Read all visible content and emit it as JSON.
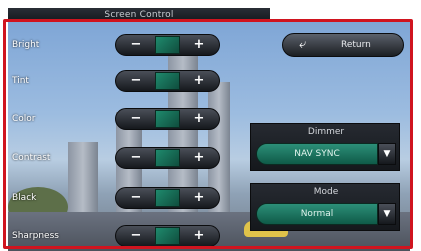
{
  "title": "Screen Control",
  "return_label": "Return",
  "adjustments": [
    {
      "label": "Bright",
      "minus": "−",
      "plus": "+"
    },
    {
      "label": "Tint",
      "minus": "−",
      "plus": "+"
    },
    {
      "label": "Color",
      "minus": "−",
      "plus": "+"
    },
    {
      "label": "Contrast",
      "minus": "−",
      "plus": "+"
    },
    {
      "label": "Black",
      "minus": "−",
      "plus": "+"
    },
    {
      "label": "Sharpness",
      "minus": "−",
      "plus": "+"
    }
  ],
  "dimmer": {
    "title": "Dimmer",
    "value": "NAV SYNC"
  },
  "mode": {
    "title": "Mode",
    "value": "Normal"
  },
  "colors": {
    "accent_teal": "#1f8a6d",
    "highlight_red": "#d0141f"
  },
  "icons": {
    "return": "return-arrow-icon",
    "dropdown": "triangle-down-icon"
  }
}
